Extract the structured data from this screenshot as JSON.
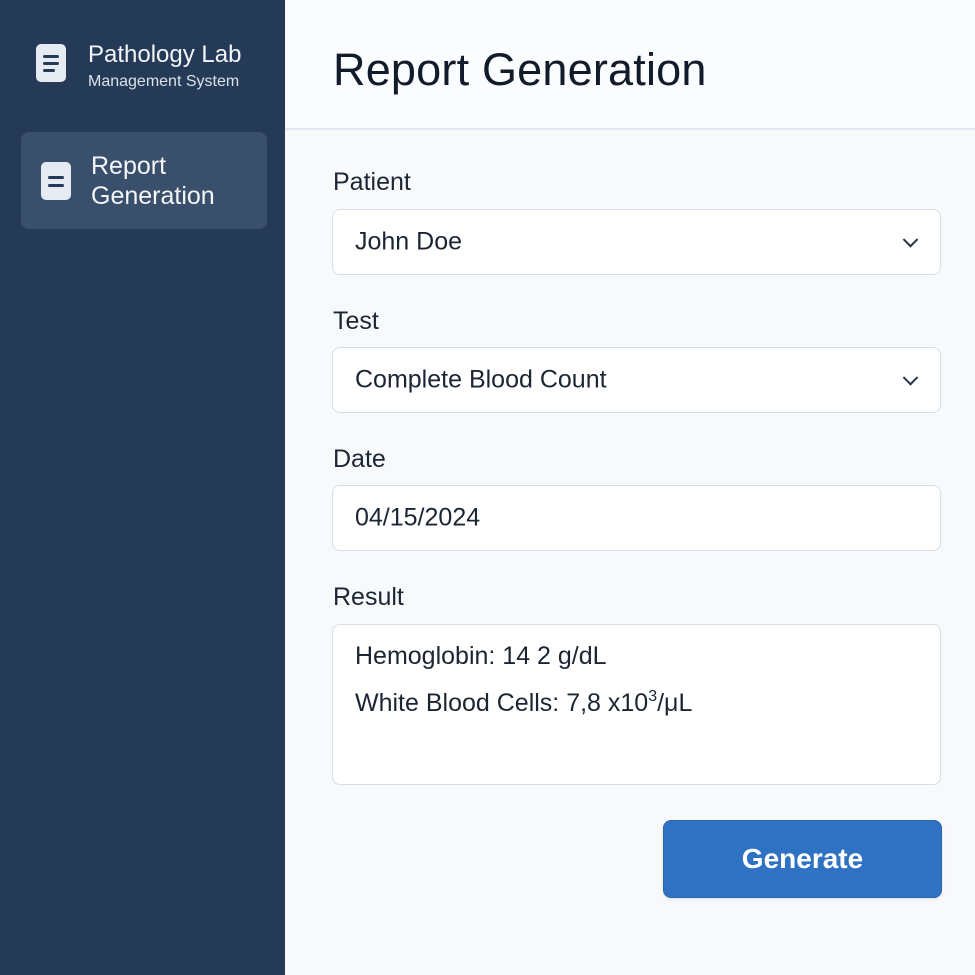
{
  "brand": {
    "title": "Pathology Lab",
    "subtitle": "Management System",
    "icon": "document-icon"
  },
  "sidebar": {
    "items": [
      {
        "label": "Report Generation",
        "icon": "document-icon",
        "active": true
      }
    ]
  },
  "page": {
    "title": "Report Generation"
  },
  "form": {
    "patient": {
      "label": "Patient",
      "value": "John Doe"
    },
    "test": {
      "label": "Test",
      "value": "Complete Blood Count"
    },
    "date": {
      "label": "Date",
      "value": "04/15/2024"
    },
    "result": {
      "label": "Result",
      "lines": [
        {
          "text": "Hemoglobin: 14 2 g/dL"
        },
        {
          "text_before": "White Blood Cells: 7,8 x10",
          "superscript": "3",
          "text_after": "/μL"
        }
      ]
    },
    "generate_label": "Generate"
  },
  "colors": {
    "sidebar_bg": "#253a56",
    "active_item_bg": "#3a4f6b",
    "primary_button": "#2f72c4",
    "page_bg": "#f8f9fb"
  }
}
